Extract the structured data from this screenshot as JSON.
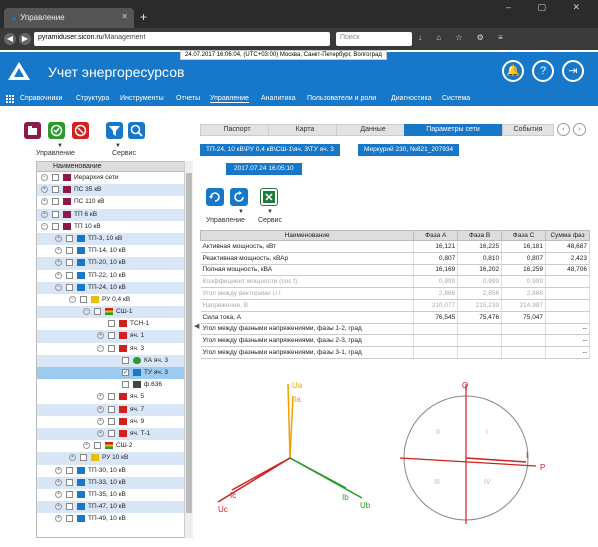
{
  "browser": {
    "tab_title": "Управление",
    "tab_close": "✕",
    "new_tab": "+",
    "url_host": "pyramiduser.sicon.ru",
    "url_path": "/Management",
    "search_placeholder": "Поиск"
  },
  "clock": "24.07.2017 16:06:04, (UTC+03:00) Москва, Санкт-Петербург, Волгоград",
  "header": {
    "title": "Учет энергоресурсов",
    "colors": {
      "bar": "#1777c9",
      "accent": "#ffffff"
    }
  },
  "menu": [
    {
      "label": "Справочники",
      "active": false
    },
    {
      "label": "Структура",
      "active": false
    },
    {
      "label": "Инструменты",
      "active": false
    },
    {
      "label": "Отчеты",
      "active": false
    },
    {
      "label": "Управление",
      "active": true
    },
    {
      "label": "Аналитика",
      "active": false
    },
    {
      "label": "Пользователи и роли",
      "active": false
    },
    {
      "label": "Диагностика",
      "active": false
    },
    {
      "label": "Система",
      "active": false
    }
  ],
  "left_toolbar": {
    "group1_label": "Управление",
    "group2_label": "Сервис"
  },
  "tree": {
    "header": "Наименование",
    "rows": [
      {
        "label": "Иерархия сети",
        "indent": 0,
        "exp": "−",
        "icon": "folder-red",
        "hl": false,
        "sel": false,
        "checked": false
      },
      {
        "label": "ПС 35 кВ",
        "indent": 0,
        "exp": "+",
        "icon": "folder-red",
        "hl": true,
        "sel": false,
        "checked": false
      },
      {
        "label": "ПС 110 кВ",
        "indent": 0,
        "exp": "+",
        "icon": "folder-red",
        "hl": false,
        "sel": false,
        "checked": false
      },
      {
        "label": "ТП 6 кВ",
        "indent": 0,
        "exp": "+",
        "icon": "folder-red",
        "hl": true,
        "sel": false,
        "checked": false
      },
      {
        "label": "ТП 10 кВ",
        "indent": 0,
        "exp": "−",
        "icon": "folder-red",
        "hl": false,
        "sel": false,
        "checked": false
      },
      {
        "label": "ТП-3, 10 кВ",
        "indent": 1,
        "exp": "+",
        "icon": "tp",
        "hl": true,
        "sel": false,
        "checked": false
      },
      {
        "label": "ТП-14, 10 кВ",
        "indent": 1,
        "exp": "+",
        "icon": "tp",
        "hl": false,
        "sel": false,
        "checked": false
      },
      {
        "label": "ТП-20, 10 кВ",
        "indent": 1,
        "exp": "+",
        "icon": "tp",
        "hl": true,
        "sel": false,
        "checked": false
      },
      {
        "label": "ТП-22, 10 кВ",
        "indent": 1,
        "exp": "+",
        "icon": "tp",
        "hl": false,
        "sel": false,
        "checked": false
      },
      {
        "label": "ТП-24, 10 кВ",
        "indent": 1,
        "exp": "−",
        "icon": "tp",
        "hl": true,
        "sel": false,
        "checked": false
      },
      {
        "label": "РУ 0,4 кВ",
        "indent": 2,
        "exp": "−",
        "icon": "warn",
        "hl": false,
        "sel": false,
        "checked": false
      },
      {
        "label": "СШ-1",
        "indent": 3,
        "exp": "−",
        "icon": "bus",
        "hl": true,
        "sel": false,
        "checked": false
      },
      {
        "label": "ТСН-1",
        "indent": 4,
        "exp": "",
        "icon": "meter-red",
        "hl": false,
        "sel": false,
        "checked": false
      },
      {
        "label": "яч. 1",
        "indent": 4,
        "exp": "+",
        "icon": "meter-red",
        "hl": true,
        "sel": false,
        "checked": false
      },
      {
        "label": "яч. 3",
        "indent": 4,
        "exp": "−",
        "icon": "meter-red",
        "hl": false,
        "sel": false,
        "checked": false
      },
      {
        "label": "КА яч. 3",
        "indent": 5,
        "exp": "",
        "icon": "ka",
        "hl": true,
        "sel": false,
        "checked": false
      },
      {
        "label": "ТУ яч. 3",
        "indent": 5,
        "exp": "",
        "icon": "tu",
        "hl": false,
        "sel": true,
        "checked": true
      },
      {
        "label": "ф.636",
        "indent": 5,
        "exp": "",
        "icon": "feeder",
        "hl": false,
        "sel": false,
        "checked": false
      },
      {
        "label": "яч. 5",
        "indent": 4,
        "exp": "+",
        "icon": "meter-red",
        "hl": false,
        "sel": false,
        "checked": false
      },
      {
        "label": "яч. 7",
        "indent": 4,
        "exp": "+",
        "icon": "meter-red",
        "hl": true,
        "sel": false,
        "checked": false
      },
      {
        "label": "яч. 9",
        "indent": 4,
        "exp": "+",
        "icon": "meter-red",
        "hl": false,
        "sel": false,
        "checked": false
      },
      {
        "label": "яч. Т-1",
        "indent": 4,
        "exp": "+",
        "icon": "meter-red",
        "hl": true,
        "sel": false,
        "checked": false
      },
      {
        "label": "СШ-2",
        "indent": 3,
        "exp": "+",
        "icon": "bus",
        "hl": false,
        "sel": false,
        "checked": false
      },
      {
        "label": "РУ 10 кВ",
        "indent": 2,
        "exp": "+",
        "icon": "warn",
        "hl": true,
        "sel": false,
        "checked": false
      },
      {
        "label": "ТП-30, 10 кВ",
        "indent": 1,
        "exp": "+",
        "icon": "tp",
        "hl": false,
        "sel": false,
        "checked": false
      },
      {
        "label": "ТП-33, 10 кВ",
        "indent": 1,
        "exp": "+",
        "icon": "tp",
        "hl": true,
        "sel": false,
        "checked": false
      },
      {
        "label": "ТП-35, 10 кВ",
        "indent": 1,
        "exp": "+",
        "icon": "tp",
        "hl": false,
        "sel": false,
        "checked": false
      },
      {
        "label": "ТП-47, 10 кВ",
        "indent": 1,
        "exp": "+",
        "icon": "tp",
        "hl": true,
        "sel": false,
        "checked": false
      },
      {
        "label": "ТП-49, 10 кВ",
        "indent": 1,
        "exp": "+",
        "icon": "tp",
        "hl": false,
        "sel": false,
        "checked": false
      }
    ]
  },
  "tabs": [
    {
      "label": "Паспорт",
      "active": false
    },
    {
      "label": "Карта",
      "active": false
    },
    {
      "label": "Данные",
      "active": false
    },
    {
      "label": "Параметры сети",
      "active": true
    },
    {
      "label": "События",
      "active": false
    }
  ],
  "breadcrumb": {
    "path": "ТП-24, 10 кВ\\РУ 0,4 кВ\\СШ-1\\яч. 3\\ТУ яч. 3",
    "device": "Меркурий 230, №821_207934",
    "date": "2017.07.24 16:05:10"
  },
  "right_toolbar": {
    "group1_label": "Управление",
    "group2_label": "Сервис"
  },
  "table": {
    "headers": [
      "Наименование",
      "Фаза А",
      "Фаза В",
      "Фаза С",
      "Сумма фаз"
    ],
    "rows": [
      {
        "name": "Активная мощность, кВт",
        "a": "16,121",
        "b": "16,225",
        "c": "16,181",
        "s": "48,687",
        "grey": false
      },
      {
        "name": "Реактивная мощность, кВАр",
        "a": "0,807",
        "b": "0,810",
        "c": "0,807",
        "s": "2,423",
        "grey": false
      },
      {
        "name": "Полная мощность, кВА",
        "a": "16,169",
        "b": "16,202",
        "c": "16,259",
        "s": "48,706",
        "grey": false
      },
      {
        "name": "Коэффициент мощности (cos f)",
        "a": "0,999",
        "b": "0,999",
        "c": "0,999",
        "s": "",
        "grey": true
      },
      {
        "name": "Угол между векторами U I",
        "a": "2,866",
        "b": "2,856",
        "c": "2,868",
        "s": "",
        "grey": true
      },
      {
        "name": "Напряжение, В",
        "a": "210,077",
        "b": "215,239",
        "c": "214,987",
        "s": "",
        "grey": true
      },
      {
        "name": "Сила тока, А",
        "a": "76,545",
        "b": "75,476",
        "c": "75,047",
        "s": "",
        "grey": false
      },
      {
        "name": "Угол между фазными напряжениями, фазы 1-2, град",
        "a": "",
        "b": "",
        "c": "",
        "s": "--",
        "grey": false
      },
      {
        "name": "Угол между фазными напряжениями, фазы 2-3, град",
        "a": "",
        "b": "",
        "c": "",
        "s": "--",
        "grey": false
      },
      {
        "name": "Угол между фазными напряжениями, фазы 3-1, град",
        "a": "",
        "b": "",
        "c": "",
        "s": "--",
        "grey": false
      }
    ]
  },
  "vector_diagram": {
    "labels": {
      "ua": "Ua",
      "ia": "Ia",
      "ub": "Ub",
      "ib": "Ib",
      "uc": "Uc",
      "ic": "Ic"
    },
    "colors": {
      "a": "#f0a000",
      "b": "#2a9a2a",
      "c": "#d02020"
    }
  },
  "power_circle": {
    "labels": {
      "q": "Q",
      "p": "P",
      "i": "I",
      "q1": "I",
      "q2": "II",
      "q3": "III",
      "q4": "IV"
    }
  }
}
